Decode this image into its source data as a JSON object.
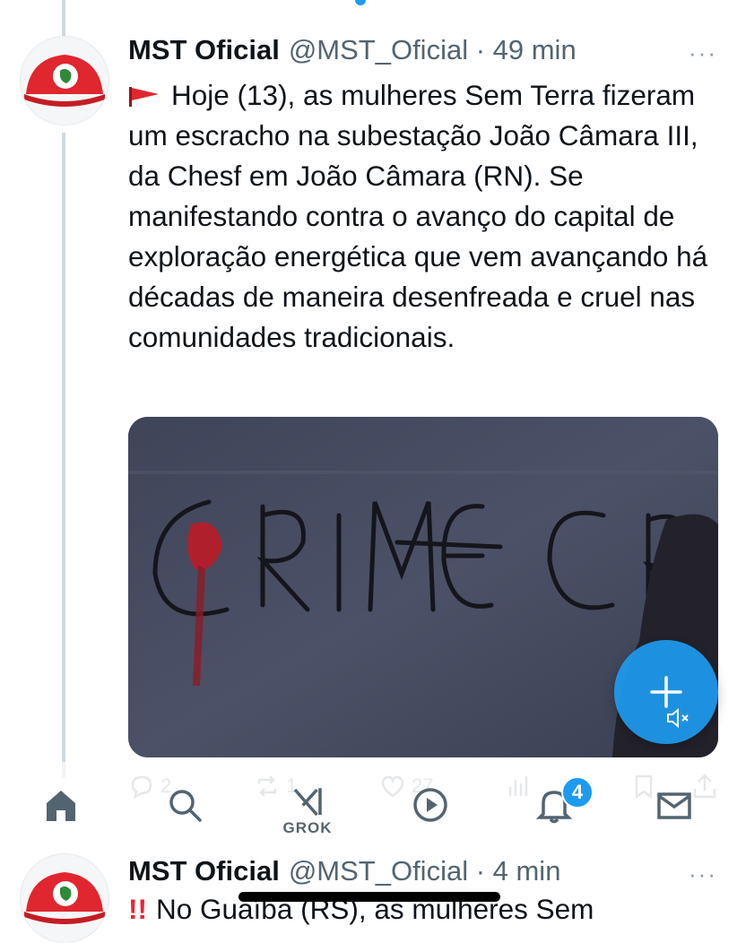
{
  "tweet1": {
    "name": "MST Oficial",
    "handle_time": "@MST_Oficial · 49 min",
    "more": "···",
    "text": "Hoje (13), as mulheres Sem Terra fizeram um escracho na subestação João Câmara III, da Chesf em João Câmara (RN). Se manifestando contra o avanço do capital de exploração energética que vem avançando há décadas de maneira desenfreada e cruel nas comunidades tradicionais.",
    "stats": {
      "replies": "2",
      "reposts": "1",
      "likes": "27"
    }
  },
  "nav": {
    "grok_label": "GROK",
    "notifications_badge": "4"
  },
  "tweet2": {
    "name": "MST Oficial",
    "handle_time": "@MST_Oficial · 4 min",
    "more": "···",
    "exclamation": "!!",
    "text": "No Guaíba (RS), as mulheres Sem"
  },
  "colors": {
    "accent": "#1d9bf0",
    "text": "#0f1419",
    "muted": "#536471",
    "brand_red": "#e0262e"
  },
  "icons": [
    "mst-cap-avatar",
    "red-flag-icon",
    "plus-icon",
    "mute-icon",
    "reply-icon",
    "repost-icon",
    "like-icon",
    "views-icon",
    "bookmark-icon",
    "share-icon",
    "home-icon",
    "search-icon",
    "grok-icon",
    "play-icon",
    "bell-icon",
    "mail-icon"
  ]
}
